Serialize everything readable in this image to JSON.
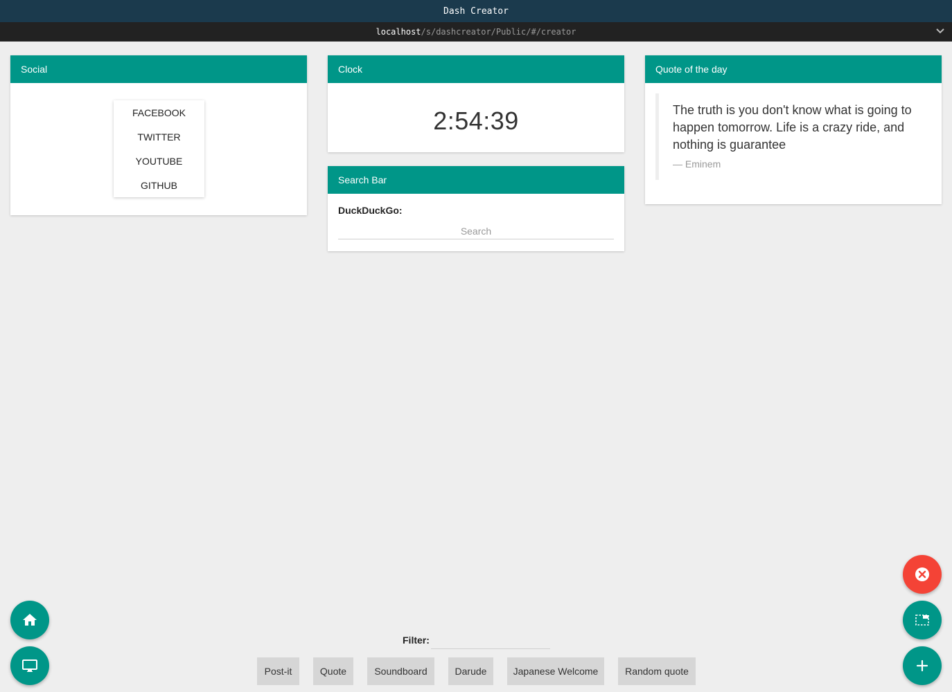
{
  "window": {
    "title": "Dash Creator"
  },
  "address": {
    "host": "localhost",
    "path": "/s/dashcreator/Public/#/creator"
  },
  "widgets": {
    "social": {
      "title": "Social",
      "links": [
        "FACEBOOK",
        "TWITTER",
        "YOUTUBE",
        "GITHUB"
      ]
    },
    "clock": {
      "title": "Clock",
      "time": "2:54:39"
    },
    "search": {
      "title": "Search Bar",
      "engine_label": "DuckDuckGo:",
      "placeholder": "Search"
    },
    "quote": {
      "title": "Quote of the day",
      "text": "The truth is you don't know what is going to happen tomorrow. Life is a crazy ride, and nothing is guarantee",
      "author": "— Eminem"
    }
  },
  "filter": {
    "label": "Filter:",
    "value": ""
  },
  "widget_buttons": [
    "Post-it",
    "Quote",
    "Soundboard",
    "Darude",
    "Japanese Welcome",
    "Random quote"
  ],
  "colors": {
    "accent": "#009688",
    "titlebar": "#1b3a4d",
    "danger": "#f44336",
    "background": "#eeeeee"
  },
  "icons": {
    "left_fabs": [
      "home-icon",
      "monitor-icon"
    ],
    "right_fabs": [
      "close-icon",
      "layout-icon",
      "add-icon"
    ],
    "addressbar": "chevron-down-icon"
  }
}
